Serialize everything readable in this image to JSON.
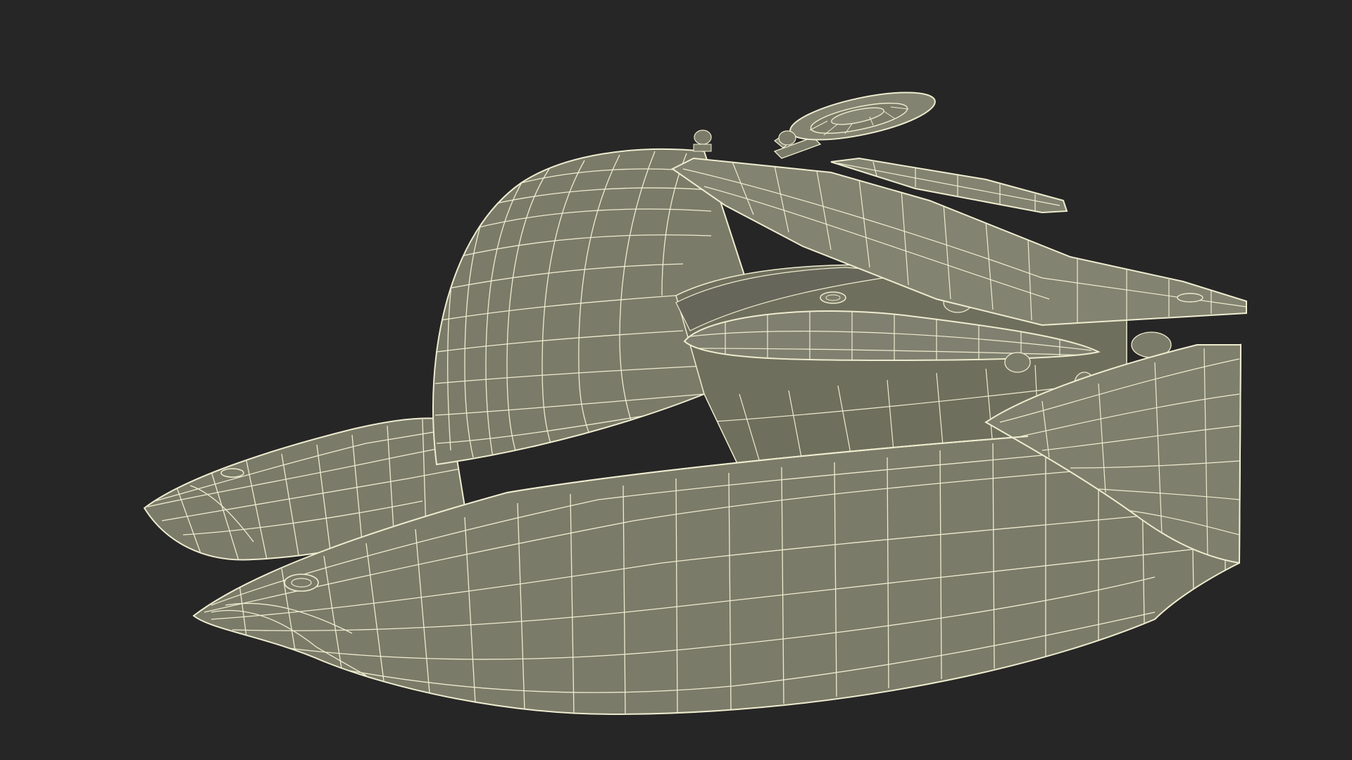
{
  "scene": {
    "subject": "wireframe-3d-model",
    "colors": {
      "background": "#262626",
      "surface": "#7b7b69",
      "surface_dark": "#6a6a59",
      "surface_light": "#868674",
      "wire": "#eeeccf",
      "shadow": "#50503f"
    }
  }
}
